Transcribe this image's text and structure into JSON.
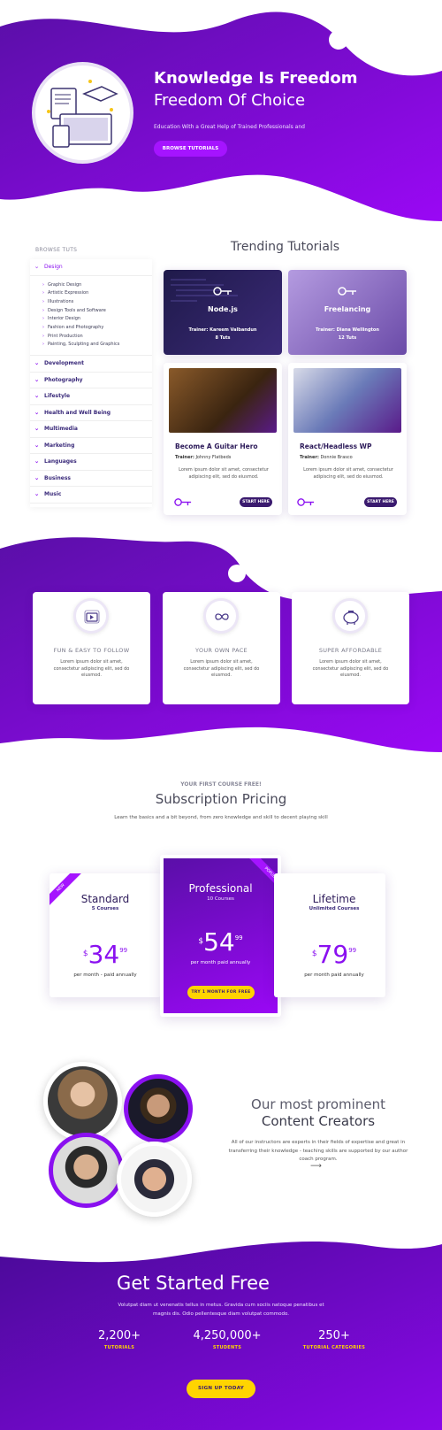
{
  "hero": {
    "title_line1": "Knowledge Is Freedom",
    "title_line2": "Freedom Of Choice",
    "subtitle": "Education With a Great Help of Trained Professionals and",
    "button": "BROWSE TUTORIALS"
  },
  "sidebar": {
    "heading": "BROWSE TUTS",
    "open_category": "Design",
    "sub_items": [
      "Graphic Design",
      "Artistic Expression",
      "Illustrations",
      "Design Tools and Software",
      "Interior Design",
      "Fashion and Photography",
      "Print Production",
      "Painting, Sculpting and Graphics"
    ],
    "categories": [
      "Development",
      "Photography",
      "Lifestyle",
      "Health and Well Being",
      "Multimedia",
      "Marketing",
      "Languages",
      "Business",
      "Music"
    ]
  },
  "trending": {
    "title": "Trending Tutorials",
    "top_cards": [
      {
        "name": "Node.js",
        "trainer": "Trainer: Kareem Valbandun",
        "count": "8 Tuts"
      },
      {
        "name": "Freelancing",
        "trainer": "Trainer: Diana Wellington",
        "count": "12 Tuts"
      }
    ],
    "bottom_cards": [
      {
        "title": "Become A Guitar Hero",
        "trainer_label": "Trainer:",
        "trainer": "Johnny Flatbeds",
        "text": "Lorem ipsum dolor sit amet, consectetur adipiscing elit, sed do eiusmod.",
        "button": "START HERE"
      },
      {
        "title": "React/Headless WP",
        "trainer_label": "Trainer:",
        "trainer": "Donnie Brasco",
        "text": "Lorem ipsum dolor sit amet, consectetur adipiscing elit, sed do eiusmod.",
        "button": "START HERE"
      }
    ]
  },
  "features": [
    {
      "icon": "video-icon",
      "title": "FUN & EASY TO FOLLOW",
      "text": "Lorem ipsum dolor sit amet, consectetur adipiscing elit, sed do eiusmod."
    },
    {
      "icon": "infinity-icon",
      "title": "YOUR OWN PACE",
      "text": "Lorem ipsum dolor sit amet, consectetur adipiscing elit, sed do eiusmod."
    },
    {
      "icon": "piggy-bank-icon",
      "title": "SUPER AFFORDABLE",
      "text": "Lorem ipsum dolor sit amet, consectetur adipiscing elit, sed do eiusmod."
    }
  ],
  "pricing": {
    "eyebrow": "YOUR FIRST COURSE FREE!",
    "title": "Subscription Pricing",
    "subtitle": "Learn the basics and a bit beyond, from zero knowledge and skill to decent playing skill",
    "plans": [
      {
        "ribbon": "NEW",
        "name": "Standard",
        "courses": "5 Courses",
        "currency": "$",
        "price": "34",
        "cents": "99",
        "period": "per month - paid annually"
      },
      {
        "ribbon": "POPULAR",
        "name": "Professional",
        "courses": "10 Courses",
        "currency": "$",
        "price": "54",
        "cents": "99",
        "period": "per month paid annually",
        "button": "TRY 1 MONTH FOR FREE"
      },
      {
        "name": "Lifetime",
        "courses": "Unlimited Courses",
        "currency": "$",
        "price": "79",
        "cents": "99",
        "period": "per month paid annually"
      }
    ]
  },
  "creators": {
    "title_line1": "Our most prominent",
    "title_line2": "Content Creators",
    "text": "All of our instructors are experts in their fields of expertise and great in transferring their knowledge - teaching skills are supported by our author coach program.",
    "arrow": "⟶"
  },
  "cta": {
    "title": "Get Started Free",
    "text": "Volutpat diam ut venenatis tellus in metus. Gravida cum sociis natoque penatibus et magnis dis. Odio pellentesque diam volutpat commodo.",
    "stats": [
      {
        "value": "2,200+",
        "label": "TUTORIALS"
      },
      {
        "value": "4,250,000+",
        "label": "STUDENTS"
      },
      {
        "value": "250+",
        "label": "TUTORIAL CATEGORIES"
      }
    ],
    "button": "SIGN UP TODAY"
  },
  "colors": {
    "primary": "#8a10f0",
    "dark": "#4a0a8a",
    "accent": "#ffd400"
  }
}
